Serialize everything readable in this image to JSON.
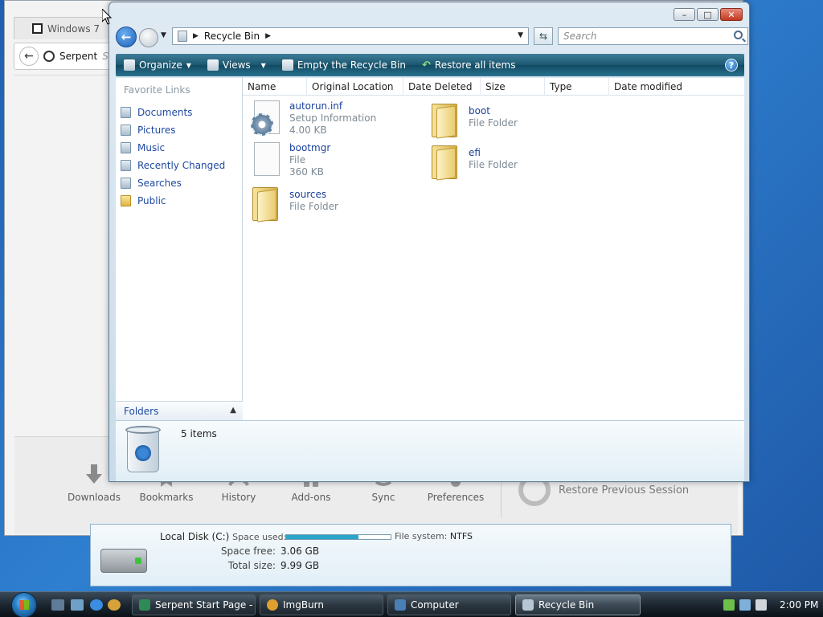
{
  "browser": {
    "tab_title": "Windows 7",
    "address_text": "Serpent",
    "address_text_cut": "Se",
    "launchers": [
      "Downloads",
      "Bookmarks",
      "History",
      "Add-ons",
      "Sync",
      "Preferences"
    ],
    "restore_session": "Restore Previous Session"
  },
  "computer_pane": {
    "drive_name": "Local Disk (C:)",
    "space_used_label": "Space used:",
    "space_used_fraction": 0.69,
    "file_system_label": "File system:",
    "file_system": "NTFS",
    "space_free_label": "Space free:",
    "space_free": "3.06 GB",
    "total_size_label": "Total size:",
    "total_size": "9.99 GB"
  },
  "explorer": {
    "breadcrumb": "Recycle Bin",
    "search_placeholder": "Search",
    "toolbar": {
      "organize": "Organize",
      "views": "Views",
      "empty": "Empty the Recycle Bin",
      "restore": "Restore all items"
    },
    "nav_heading": "Favorite Links",
    "nav_items": [
      {
        "label": "Documents",
        "icon": "documents-icon"
      },
      {
        "label": "Pictures",
        "icon": "pictures-icon"
      },
      {
        "label": "Music",
        "icon": "music-icon"
      },
      {
        "label": "Recently Changed",
        "icon": "recently-changed-icon"
      },
      {
        "label": "Searches",
        "icon": "searches-icon"
      },
      {
        "label": "Public",
        "icon": "folder-icon"
      }
    ],
    "folders_label": "Folders",
    "columns": [
      "Name",
      "Original Location",
      "Date Deleted",
      "Size",
      "Type",
      "Date modified"
    ],
    "items": [
      {
        "name": "autorun.inf",
        "type": "Setup Information",
        "size": "4.00 KB",
        "icon": "settings-file-icon"
      },
      {
        "name": "boot",
        "type": "File Folder",
        "size": "",
        "icon": "folder-icon"
      },
      {
        "name": "bootmgr",
        "type": "File",
        "size": "360 KB",
        "icon": "file-icon"
      },
      {
        "name": "efi",
        "type": "File Folder",
        "size": "",
        "icon": "folder-icon"
      },
      {
        "name": "sources",
        "type": "File Folder",
        "size": "",
        "icon": "folder-icon"
      }
    ],
    "status_count": "5 items"
  },
  "taskbar": {
    "buttons": [
      {
        "label": "Serpent Start Page - ...",
        "icon": "serpent-icon",
        "active": false
      },
      {
        "label": "ImgBurn",
        "icon": "imgburn-icon",
        "active": false
      },
      {
        "label": "Computer",
        "icon": "computer-icon",
        "active": false
      },
      {
        "label": "Recycle Bin",
        "icon": "recycle-bin-icon",
        "active": true
      }
    ],
    "clock": "2:00 PM"
  },
  "colors": {
    "desktop": "#2f7fd0",
    "link_blue": "#1a3f9b",
    "toolbar_teal": "#1d5871",
    "taskbar": "#1d2731"
  }
}
